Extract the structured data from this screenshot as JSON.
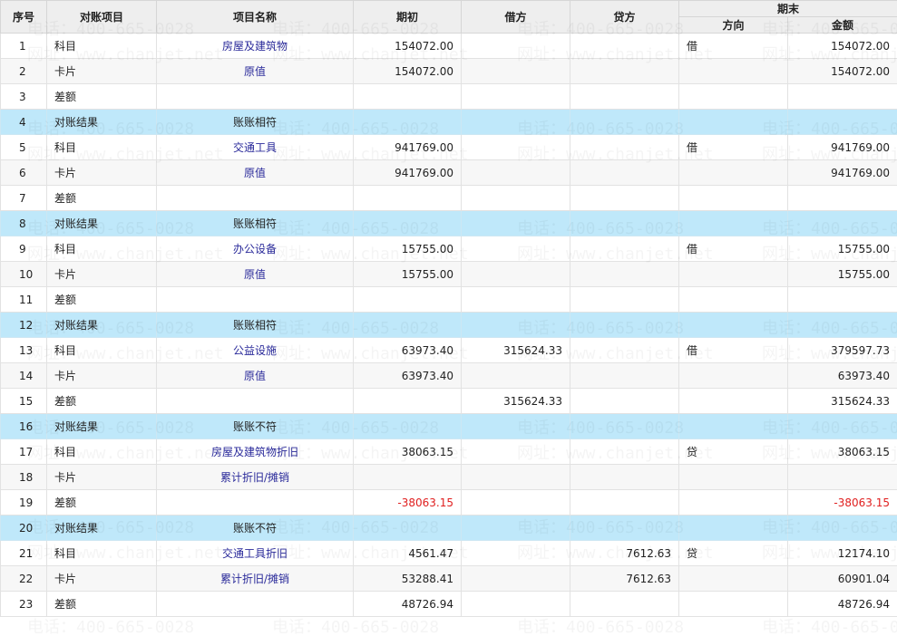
{
  "headers": {
    "seq": "序号",
    "item": "对账项目",
    "name": "项目名称",
    "opening": "期初",
    "debit": "借方",
    "credit": "贷方",
    "closing": "期末",
    "direction": "方向",
    "amount": "金额"
  },
  "watermark": {
    "phone": "电话：400-665-0028",
    "site": "网址：www.chanjet.net"
  },
  "colors": {
    "result_row": "#bfe8fa",
    "link": "#2a2a9a",
    "negative": "#e02020"
  },
  "rows": [
    {
      "seq": "1",
      "item": "科目",
      "name": "房屋及建筑物",
      "opening": "154072.00",
      "debit": "",
      "credit": "",
      "dir": "借",
      "amount": "154072.00",
      "type": "normal"
    },
    {
      "seq": "2",
      "item": "卡片",
      "name": "原值",
      "opening": "154072.00",
      "debit": "",
      "credit": "",
      "dir": "",
      "amount": "154072.00",
      "type": "normal"
    },
    {
      "seq": "3",
      "item": "差额",
      "name": "",
      "opening": "",
      "debit": "",
      "credit": "",
      "dir": "",
      "amount": "",
      "type": "normal"
    },
    {
      "seq": "4",
      "item": "对账结果",
      "name": "账账相符",
      "opening": "",
      "debit": "",
      "credit": "",
      "dir": "",
      "amount": "",
      "type": "result"
    },
    {
      "seq": "5",
      "item": "科目",
      "name": "交通工具",
      "opening": "941769.00",
      "debit": "",
      "credit": "",
      "dir": "借",
      "amount": "941769.00",
      "type": "normal"
    },
    {
      "seq": "6",
      "item": "卡片",
      "name": "原值",
      "opening": "941769.00",
      "debit": "",
      "credit": "",
      "dir": "",
      "amount": "941769.00",
      "type": "normal"
    },
    {
      "seq": "7",
      "item": "差额",
      "name": "",
      "opening": "",
      "debit": "",
      "credit": "",
      "dir": "",
      "amount": "",
      "type": "normal"
    },
    {
      "seq": "8",
      "item": "对账结果",
      "name": "账账相符",
      "opening": "",
      "debit": "",
      "credit": "",
      "dir": "",
      "amount": "",
      "type": "result"
    },
    {
      "seq": "9",
      "item": "科目",
      "name": "办公设备",
      "opening": "15755.00",
      "debit": "",
      "credit": "",
      "dir": "借",
      "amount": "15755.00",
      "type": "normal"
    },
    {
      "seq": "10",
      "item": "卡片",
      "name": "原值",
      "opening": "15755.00",
      "debit": "",
      "credit": "",
      "dir": "",
      "amount": "15755.00",
      "type": "normal"
    },
    {
      "seq": "11",
      "item": "差额",
      "name": "",
      "opening": "",
      "debit": "",
      "credit": "",
      "dir": "",
      "amount": "",
      "type": "normal"
    },
    {
      "seq": "12",
      "item": "对账结果",
      "name": "账账相符",
      "opening": "",
      "debit": "",
      "credit": "",
      "dir": "",
      "amount": "",
      "type": "result"
    },
    {
      "seq": "13",
      "item": "科目",
      "name": "公益设施",
      "opening": "63973.40",
      "debit": "315624.33",
      "credit": "",
      "dir": "借",
      "amount": "379597.73",
      "type": "normal"
    },
    {
      "seq": "14",
      "item": "卡片",
      "name": "原值",
      "opening": "63973.40",
      "debit": "",
      "credit": "",
      "dir": "",
      "amount": "63973.40",
      "type": "normal"
    },
    {
      "seq": "15",
      "item": "差额",
      "name": "",
      "opening": "",
      "debit": "315624.33",
      "credit": "",
      "dir": "",
      "amount": "315624.33",
      "type": "normal"
    },
    {
      "seq": "16",
      "item": "对账结果",
      "name": "账账不符",
      "opening": "",
      "debit": "",
      "credit": "",
      "dir": "",
      "amount": "",
      "type": "result",
      "bad": true
    },
    {
      "seq": "17",
      "item": "科目",
      "name": "房屋及建筑物折旧",
      "opening": "38063.15",
      "debit": "",
      "credit": "",
      "dir": "贷",
      "amount": "38063.15",
      "type": "normal"
    },
    {
      "seq": "18",
      "item": "卡片",
      "name": "累计折旧/摊销",
      "opening": "",
      "debit": "",
      "credit": "",
      "dir": "",
      "amount": "",
      "type": "normal"
    },
    {
      "seq": "19",
      "item": "差额",
      "name": "",
      "opening": "-38063.15",
      "debit": "",
      "credit": "",
      "dir": "",
      "amount": "-38063.15",
      "type": "normal",
      "neg": true
    },
    {
      "seq": "20",
      "item": "对账结果",
      "name": "账账不符",
      "opening": "",
      "debit": "",
      "credit": "",
      "dir": "",
      "amount": "",
      "type": "result",
      "bad": true
    },
    {
      "seq": "21",
      "item": "科目",
      "name": "交通工具折旧",
      "opening": "4561.47",
      "debit": "",
      "credit": "7612.63",
      "dir": "贷",
      "amount": "12174.10",
      "type": "normal"
    },
    {
      "seq": "22",
      "item": "卡片",
      "name": "累计折旧/摊销",
      "opening": "53288.41",
      "debit": "",
      "credit": "7612.63",
      "dir": "",
      "amount": "60901.04",
      "type": "normal"
    },
    {
      "seq": "23",
      "item": "差额",
      "name": "",
      "opening": "48726.94",
      "debit": "",
      "credit": "",
      "dir": "",
      "amount": "48726.94",
      "type": "normal"
    }
  ]
}
